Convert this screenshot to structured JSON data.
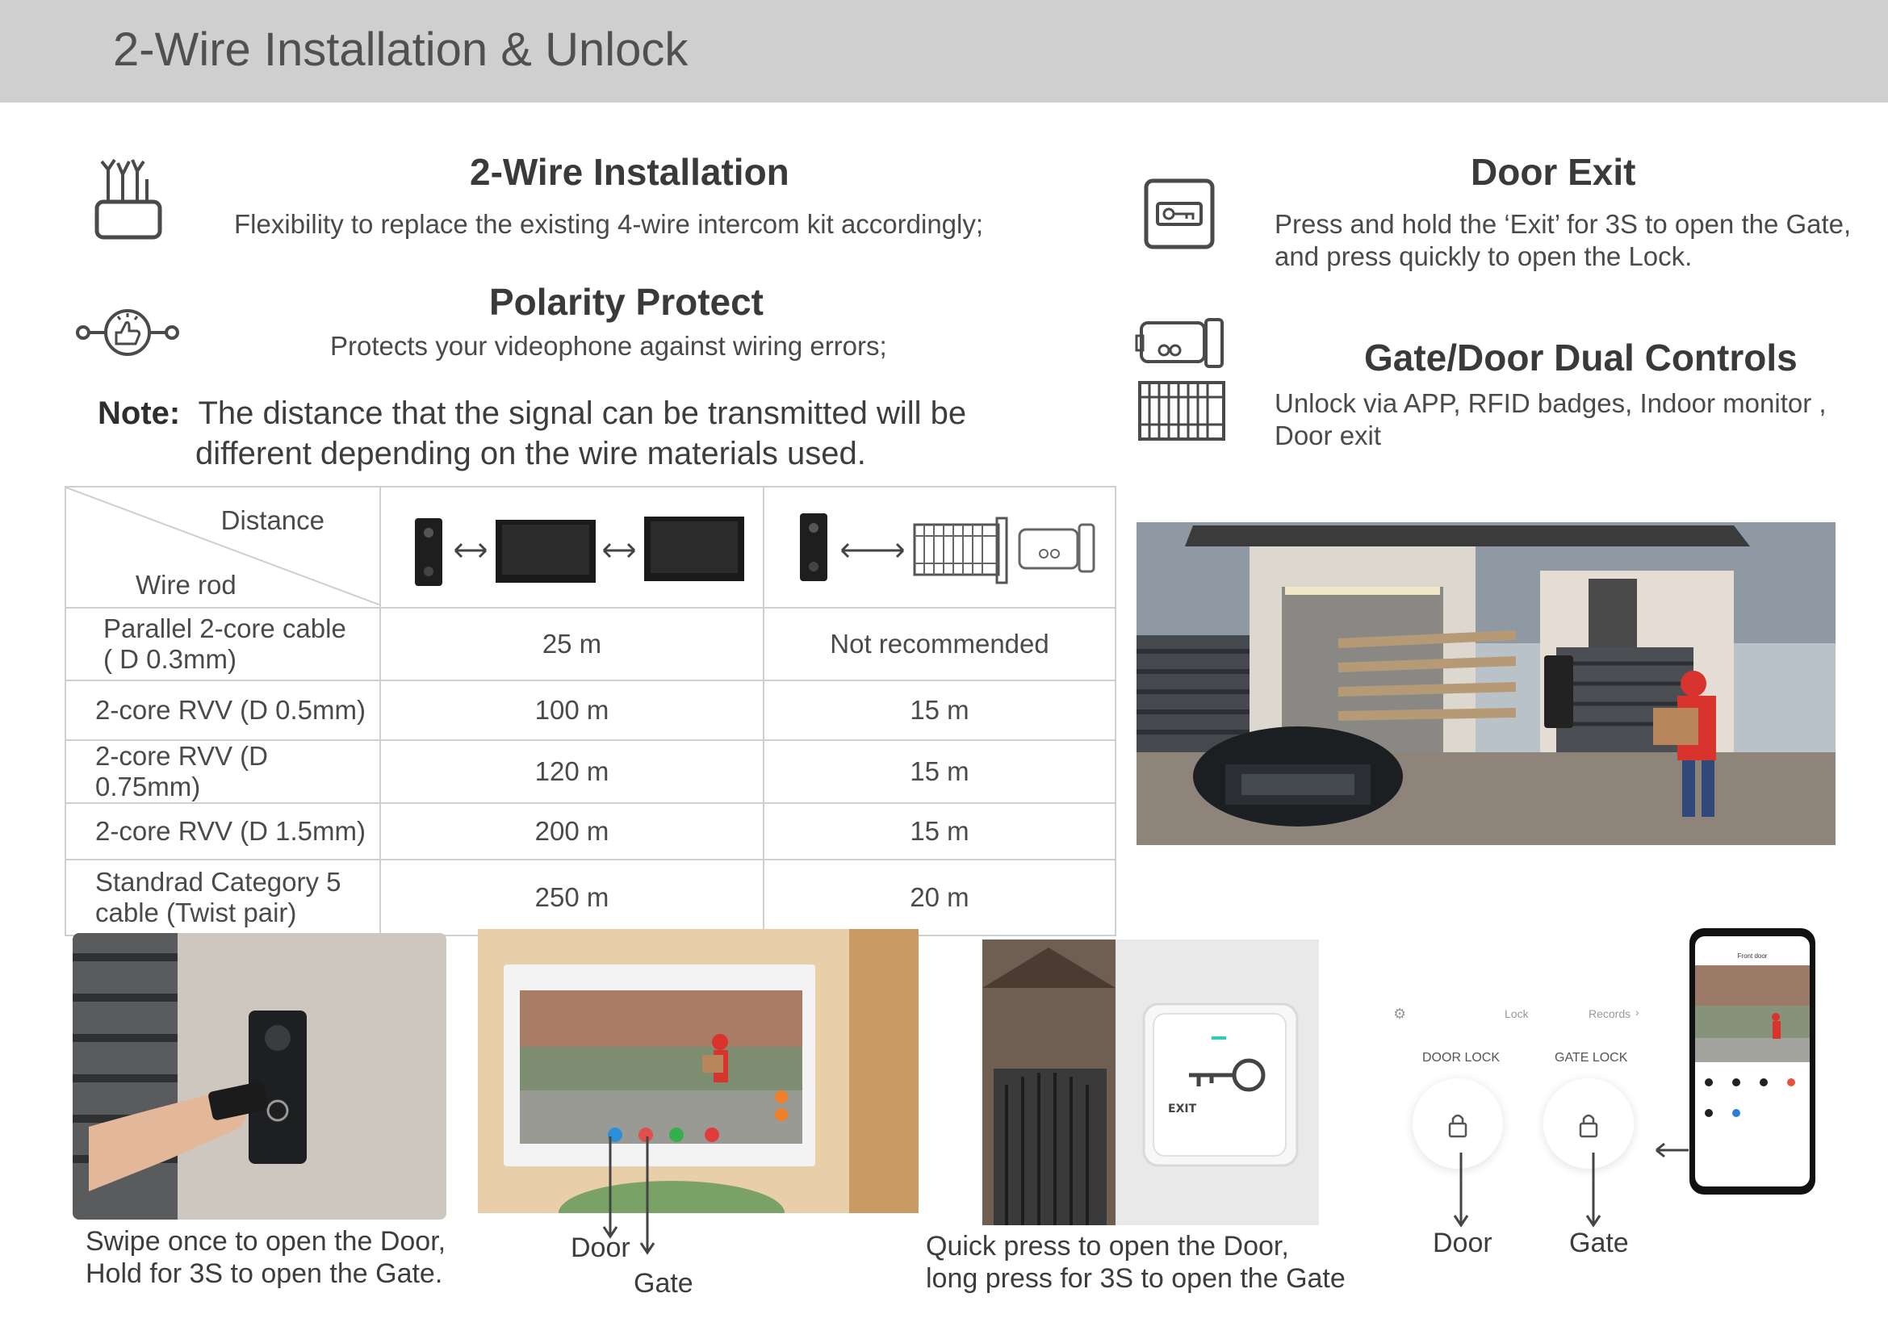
{
  "header": {
    "title": "2-Wire Installation & Unlock"
  },
  "features": {
    "install": {
      "title": "2-Wire Installation",
      "desc": "Flexibility to replace the existing 4-wire intercom kit accordingly;"
    },
    "polarity": {
      "title": "Polarity Protect",
      "desc": "Protects your videophone against wiring errors;"
    },
    "door_exit": {
      "title": "Door Exit",
      "desc1": "Press and hold the ‘Exit’  for 3S to open the Gate,",
      "desc2": "and press quickly to open the Lock."
    },
    "dual": {
      "title": "Gate/Door Dual Controls",
      "desc1": "Unlock via APP, RFID badges, Indoor monitor ,",
      "desc2": "Door exit"
    }
  },
  "note": {
    "label": "Note:",
    "line1": "The distance that the signal can be transmitted will be",
    "line2": "different depending on the wire materials used."
  },
  "table": {
    "corner_top": "Distance",
    "corner_bottom": "Wire rod",
    "rows": [
      {
        "wire1": "Parallel 2-core cable",
        "wire2": "( D 0.3mm)",
        "monitor": "25 m",
        "gate": "Not recommended"
      },
      {
        "wire1": "2-core RVV (D 0.5mm)",
        "wire2": "",
        "monitor": "100 m",
        "gate": "15 m"
      },
      {
        "wire1": "2-core RVV (D 0.75mm)",
        "wire2": "",
        "monitor": "120 m",
        "gate": "15 m"
      },
      {
        "wire1": "2-core RVV (D 1.5mm)",
        "wire2": "",
        "monitor": "200 m",
        "gate": "15 m"
      },
      {
        "wire1": "Standrad Category 5",
        "wire2": "cable (Twist pair)",
        "monitor": "250 m",
        "gate": "20 m"
      }
    ]
  },
  "captions": {
    "rfid1": "Swipe once to open the Door,",
    "rfid2": "Hold for 3S to open the Gate.",
    "monitor_door": "Door",
    "monitor_gate": "Gate",
    "exit1": "Quick press to open the Door,",
    "exit2": "long press for 3S to open the Gate",
    "app_door": "Door",
    "app_gate": "Gate"
  },
  "app": {
    "top_lock": "Lock",
    "top_records": "Records",
    "door_lock": "DOOR LOCK",
    "gate_lock": "GATE LOCK",
    "phone_title": "Front door"
  },
  "exit_button_label": "EXIT",
  "colors": {
    "header_bg": "#cfcfcf",
    "title_text": "#505050",
    "table_border": "#cfcfcf",
    "courier_red": "#d8332c"
  }
}
